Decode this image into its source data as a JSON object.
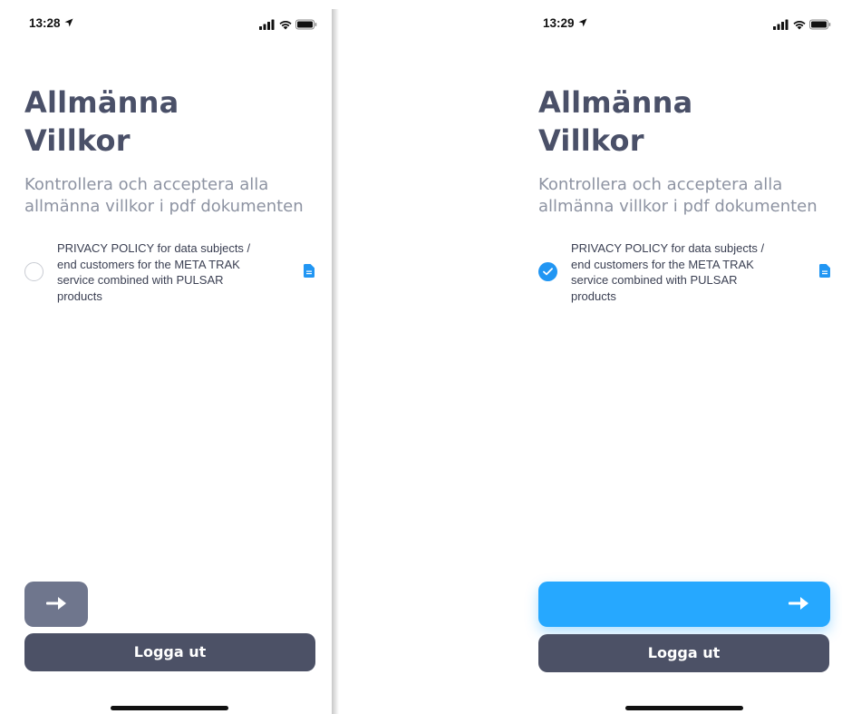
{
  "screens": [
    {
      "status_time": "13:28",
      "title_line1": "Allmänna",
      "title_line2": "Villkor",
      "subtitle_line1": "Kontrollera och acceptera alla",
      "subtitle_line2": "allmänna villkor i pdf dokumenten",
      "document": {
        "line1": "PRIVACY POLICY for data subjects /",
        "line2": "end customers for the META TRAK",
        "line3": "service combined with PULSAR",
        "line4": "products",
        "accepted": false
      },
      "next_button_state": "disabled",
      "logout_label": "Logga ut"
    },
    {
      "status_time": "13:29",
      "title_line1": "Allmänna",
      "title_line2": "Villkor",
      "subtitle_line1": "Kontrollera och acceptera alla",
      "subtitle_line2": "allmänna villkor i pdf dokumenten",
      "document": {
        "line1": "PRIVACY POLICY for data subjects /",
        "line2": "end customers for the META TRAK",
        "line3": "service combined with PULSAR",
        "line4": "products",
        "accepted": true
      },
      "next_button_state": "enabled",
      "logout_label": "Logga ut"
    }
  ],
  "colors": {
    "title": "#4a5068",
    "subtitle": "#8d93a2",
    "accent_blue": "#26a8ff",
    "check_blue": "#2196f3",
    "disabled_button": "#6f768d",
    "logout_button": "#4c5166"
  },
  "icons": {
    "location": "location-arrow-icon",
    "signal": "cellular-signal-icon",
    "wifi": "wifi-icon",
    "battery": "battery-icon",
    "document": "document-icon",
    "arrow": "arrow-right-icon",
    "check": "checkmark-icon"
  }
}
